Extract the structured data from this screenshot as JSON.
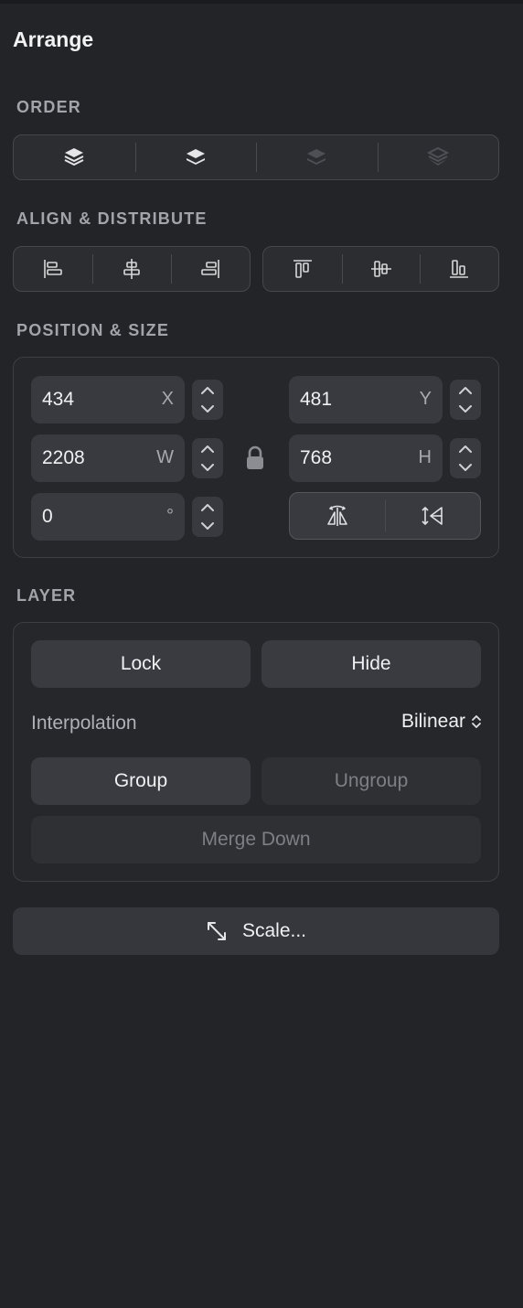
{
  "panel": {
    "title": "Arrange"
  },
  "order": {
    "label": "ORDER",
    "buttons": [
      {
        "icon": "bring-to-front-icon",
        "enabled": true
      },
      {
        "icon": "bring-forward-icon",
        "enabled": true
      },
      {
        "icon": "send-backward-icon",
        "enabled": false
      },
      {
        "icon": "send-to-back-icon",
        "enabled": false
      }
    ]
  },
  "align": {
    "label": "ALIGN & DISTRIBUTE",
    "horizontal": [
      "align-left-icon",
      "align-center-horizontal-icon",
      "align-right-icon"
    ],
    "vertical": [
      "align-top-icon",
      "align-center-vertical-icon",
      "align-bottom-icon"
    ]
  },
  "position": {
    "label": "POSITION & SIZE",
    "x": {
      "value": "434",
      "unit": "X"
    },
    "y": {
      "value": "481",
      "unit": "Y"
    },
    "w": {
      "value": "2208",
      "unit": "W"
    },
    "h": {
      "value": "768",
      "unit": "H"
    },
    "rotation": {
      "value": "0",
      "unit": "°"
    },
    "flip_icons": [
      "flip-horizontal-icon",
      "flip-vertical-icon"
    ],
    "lock_icon": "lock-icon"
  },
  "layer": {
    "label": "LAYER",
    "lock_label": "Lock",
    "hide_label": "Hide",
    "interpolation_label": "Interpolation",
    "interpolation_value": "Bilinear",
    "group_label": "Group",
    "ungroup_label": "Ungroup",
    "merge_label": "Merge Down"
  },
  "scale": {
    "label": "Scale..."
  },
  "colors": {
    "background": "#232428",
    "button": "#3a3b40",
    "disabled_text": "#7e7f84"
  }
}
